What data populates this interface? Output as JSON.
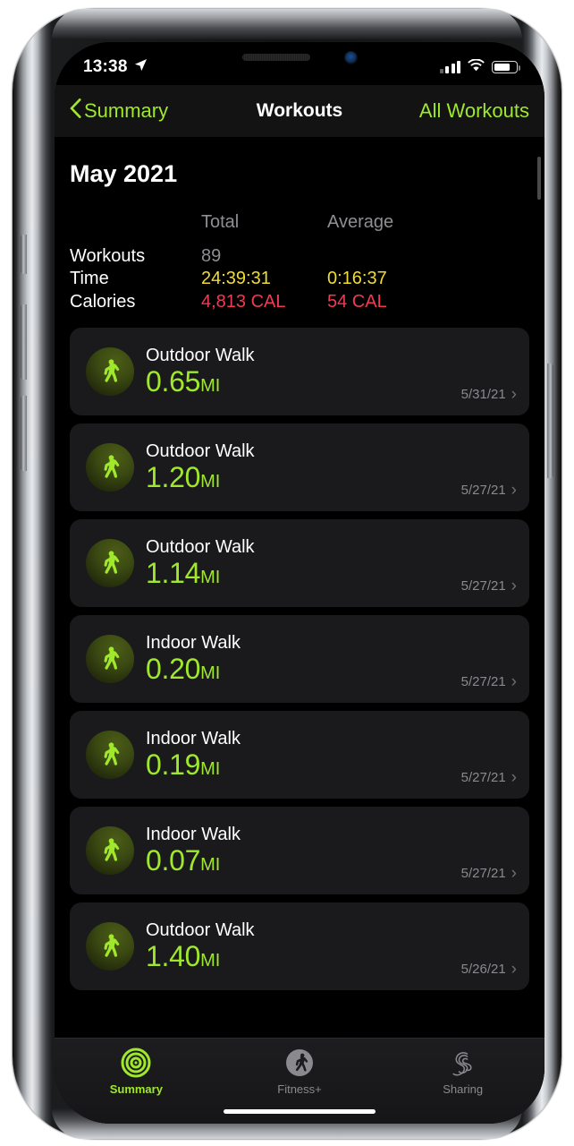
{
  "status_bar": {
    "time": "13:38",
    "location_icon": "location-arrow-icon",
    "signal_icon": "cellular-signal-icon",
    "wifi_icon": "wifi-icon",
    "battery_icon": "battery-icon"
  },
  "nav": {
    "back_label": "Summary",
    "back_icon": "chevron-left-icon",
    "title": "Workouts",
    "right_label": "All Workouts"
  },
  "content": {
    "month_title": "May 2021",
    "stats": {
      "col_total": "Total",
      "col_average": "Average",
      "rows": [
        {
          "label": "Workouts",
          "total": "89",
          "average": "",
          "color": "gray"
        },
        {
          "label": "Time",
          "total": "24:39:31",
          "average": "0:16:37",
          "color": "yellow"
        },
        {
          "label": "Calories",
          "total": "4,813 CAL",
          "average": "54 CAL",
          "color": "red"
        }
      ]
    },
    "workouts": [
      {
        "title": "Outdoor Walk",
        "value": "0.65",
        "unit": "MI",
        "date": "5/31/21",
        "icon": "walking-figure-icon"
      },
      {
        "title": "Outdoor Walk",
        "value": "1.20",
        "unit": "MI",
        "date": "5/27/21",
        "icon": "walking-figure-icon"
      },
      {
        "title": "Outdoor Walk",
        "value": "1.14",
        "unit": "MI",
        "date": "5/27/21",
        "icon": "walking-figure-icon"
      },
      {
        "title": "Indoor Walk",
        "value": "0.20",
        "unit": "MI",
        "date": "5/27/21",
        "icon": "walking-figure-icon"
      },
      {
        "title": "Indoor Walk",
        "value": "0.19",
        "unit": "MI",
        "date": "5/27/21",
        "icon": "walking-figure-icon"
      },
      {
        "title": "Indoor Walk",
        "value": "0.07",
        "unit": "MI",
        "date": "5/27/21",
        "icon": "walking-figure-icon"
      },
      {
        "title": "Outdoor Walk",
        "value": "1.40",
        "unit": "MI",
        "date": "5/26/21",
        "icon": "walking-figure-icon"
      }
    ],
    "chevron": "›"
  },
  "tab_bar": {
    "items": [
      {
        "label": "Summary",
        "icon": "activity-rings-icon",
        "active": true
      },
      {
        "label": "Fitness+",
        "icon": "running-figure-icon",
        "active": false
      },
      {
        "label": "Sharing",
        "icon": "sharing-s-icon",
        "active": false
      }
    ]
  },
  "colors": {
    "accent_green": "#9FE82C",
    "time_yellow": "#F0DD2E",
    "calories_red": "#F03A51",
    "secondary_gray": "#8E8E93",
    "card_background": "#1A1A1C",
    "screen_background": "#000000"
  }
}
